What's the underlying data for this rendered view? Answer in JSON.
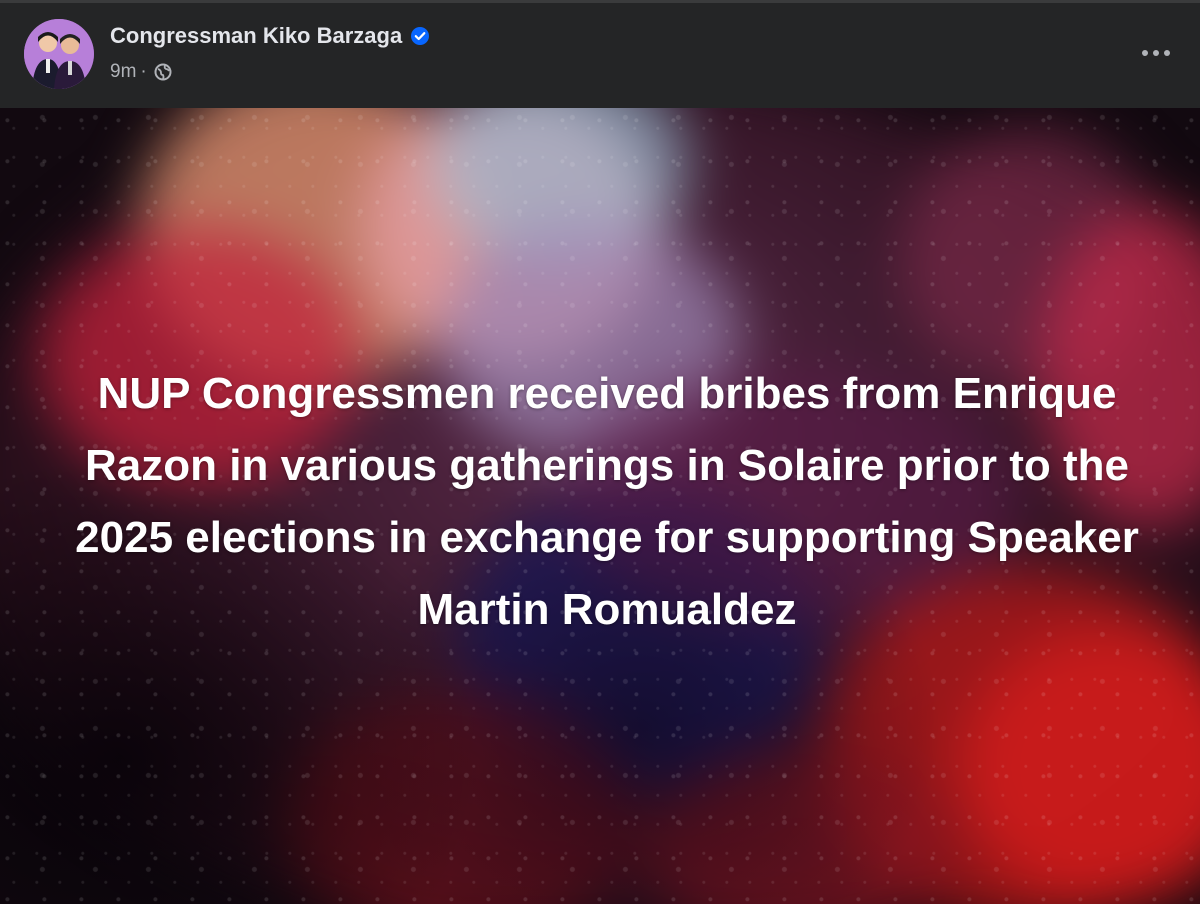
{
  "post": {
    "author": "Congressman Kiko Barzaga",
    "timestamp": "9m",
    "separator": "·",
    "audience_icon": "globe-icon",
    "verified_icon": "verified-badge-icon",
    "more_icon": "more-options-icon",
    "body_text": "NUP Congressmen received bribes from Enrique Razon in various gatherings in Solaire prior to the 2025 elections in exchange for supporting Speaker Martin Romualdez"
  },
  "colors": {
    "background": "#242526",
    "author_text": "#e4e6eb",
    "meta_text": "#b0b3b8",
    "verified_badge": "#0866ff",
    "post_text": "#ffffff"
  }
}
